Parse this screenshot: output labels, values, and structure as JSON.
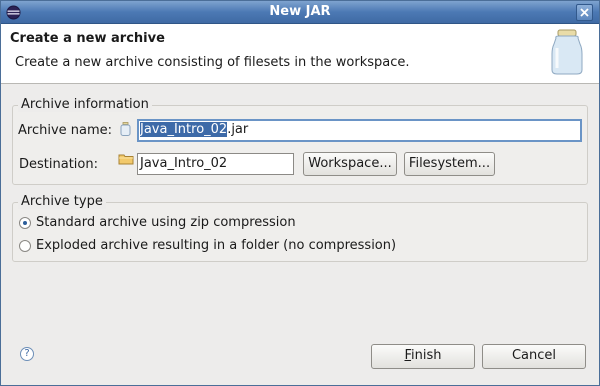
{
  "window": {
    "title": "New JAR"
  },
  "banner": {
    "title": "Create a new archive",
    "description": "Create a new archive consisting of filesets in the workspace."
  },
  "archive_info": {
    "legend": "Archive information",
    "name_label": "Archive name:",
    "name_selected": "Java_Intro_02",
    "name_suffix": ".jar",
    "destination_label": "Destination:",
    "destination_value": "Java_Intro_02",
    "workspace_button": "Workspace...",
    "filesystem_button": "Filesystem..."
  },
  "archive_type": {
    "legend": "Archive type",
    "options": [
      {
        "label": "Standard archive using zip compression",
        "selected": true
      },
      {
        "label": "Exploded archive resulting in a folder (no compression)",
        "selected": false
      }
    ]
  },
  "footer": {
    "help_glyph": "?",
    "finish_mnemonic": "F",
    "finish_rest": "inish",
    "cancel_label": "Cancel"
  },
  "colors": {
    "title_bar": "#4c79b4",
    "selection": "#3d6aa8"
  }
}
